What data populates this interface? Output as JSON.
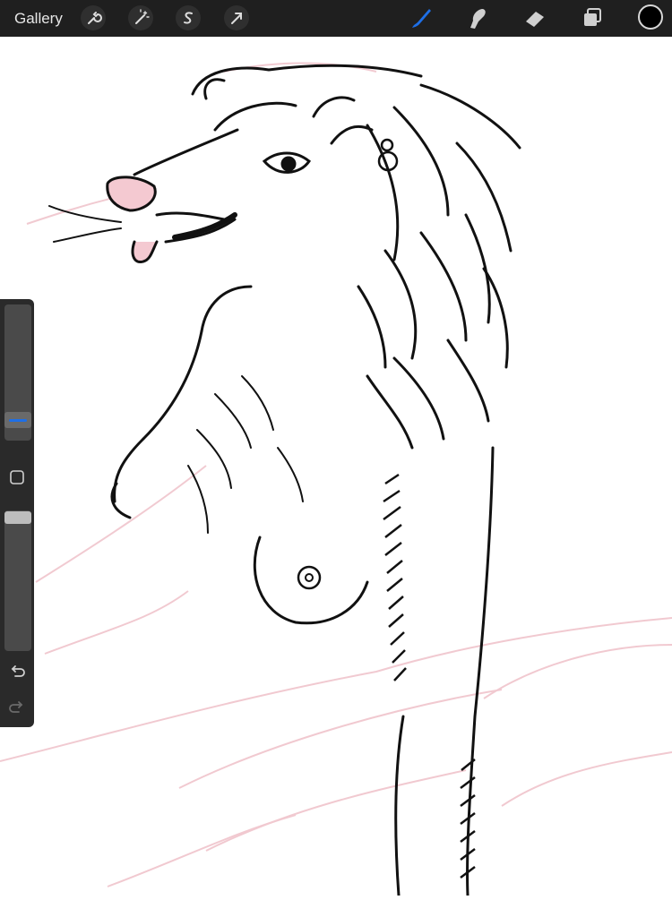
{
  "app": {
    "gallery_label": "Gallery"
  },
  "toolbar_left": [
    {
      "name": "actions",
      "icon": "wrench-icon"
    },
    {
      "name": "adjustments",
      "icon": "magic-wand-icon"
    },
    {
      "name": "selection",
      "icon": "selection-s-icon"
    },
    {
      "name": "transform",
      "icon": "arrow-cursor-icon"
    }
  ],
  "toolbar_right": [
    {
      "name": "brush",
      "icon": "brush-icon",
      "active": true
    },
    {
      "name": "smudge",
      "icon": "smudge-finger-icon"
    },
    {
      "name": "eraser",
      "icon": "eraser-icon"
    },
    {
      "name": "layers",
      "icon": "layers-icon"
    }
  ],
  "colors": {
    "toolbar_bg": "#1f1f1f",
    "active_tool": "#1e6fe6",
    "current_color": "#000000",
    "sketch_line": "#f0c4cc",
    "ink_line": "#111111"
  },
  "sidebar": {
    "brush_size_level": 0.25,
    "opacity_level": 1.0,
    "undo_icon": "undo-arrow-icon",
    "redo_icon": "redo-arrow-icon",
    "modify_icon": "square-modify-icon"
  }
}
